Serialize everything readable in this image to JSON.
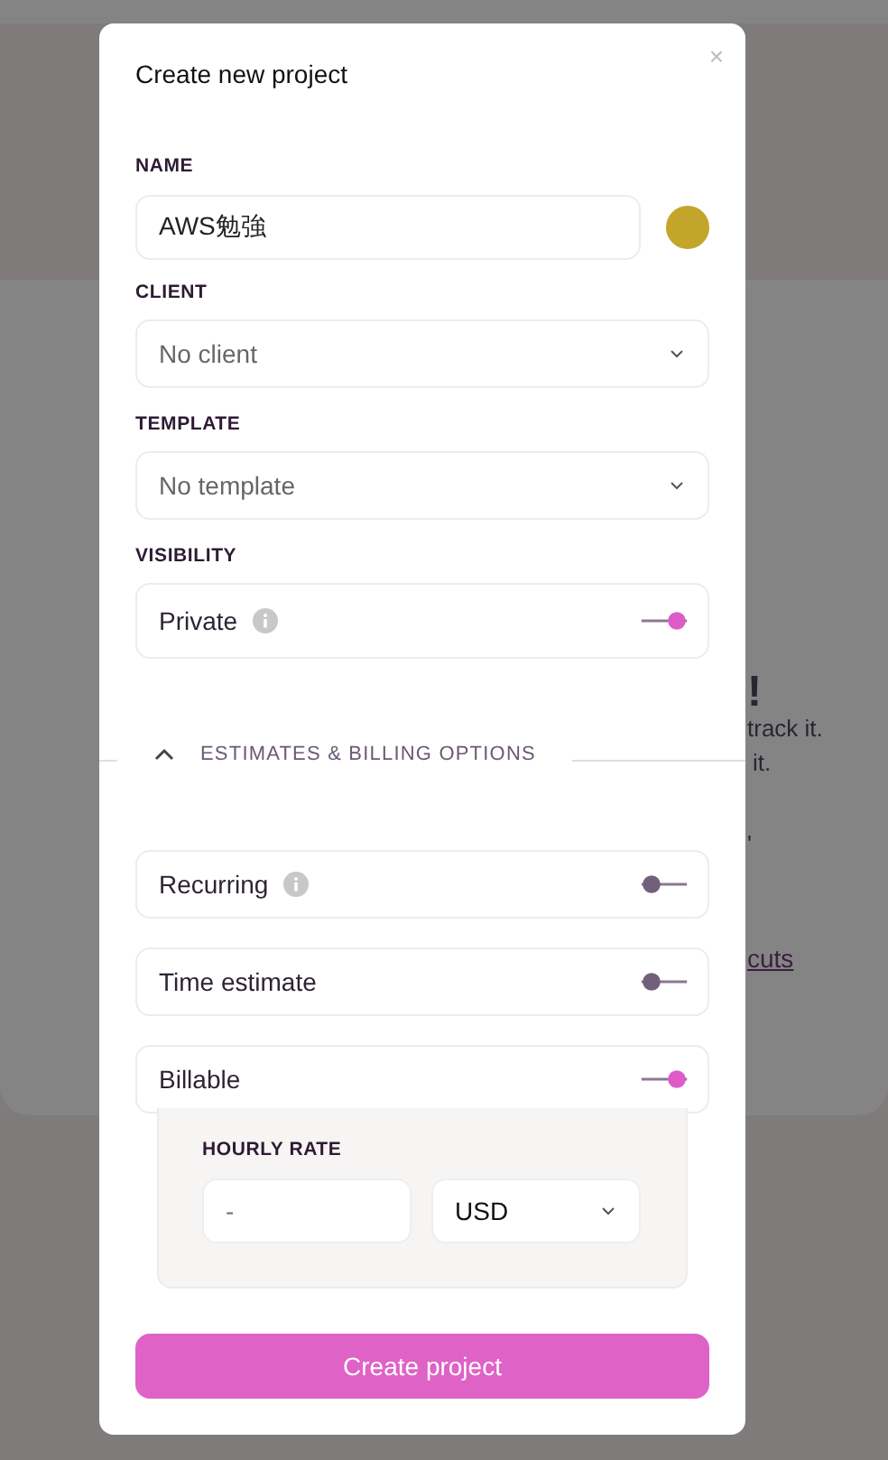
{
  "background": {
    "fragments": [
      {
        "kind": "heading",
        "text": "!"
      },
      {
        "kind": "text",
        "text": "track it."
      },
      {
        "kind": "text",
        "text": "it."
      },
      {
        "kind": "text",
        "text": "'"
      },
      {
        "kind": "link",
        "text": "cuts"
      }
    ]
  },
  "dialog": {
    "title": "Create new project",
    "close": "×",
    "name": {
      "label": "NAME",
      "value": "AWS勉強",
      "color": "#c4a52c"
    },
    "client": {
      "label": "CLIENT",
      "value": "No client"
    },
    "template": {
      "label": "TEMPLATE",
      "value": "No template"
    },
    "visibility": {
      "label": "VISIBILITY",
      "option": {
        "label": "Private",
        "info": true,
        "on": true
      }
    },
    "section": {
      "title": "ESTIMATES & BILLING OPTIONS",
      "expanded": true
    },
    "options": [
      {
        "label": "Recurring",
        "info": true,
        "on": false
      },
      {
        "label": "Time estimate",
        "info": false,
        "on": false
      },
      {
        "label": "Billable",
        "info": false,
        "on": true
      }
    ],
    "hourly_rate": {
      "label": "HOURLY RATE",
      "placeholder": "-",
      "currency": "USD"
    },
    "submit": "Create project"
  }
}
